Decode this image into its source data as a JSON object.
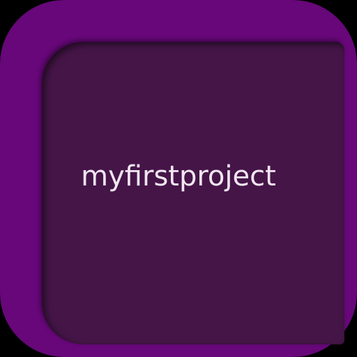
{
  "app_icon": {
    "label": "myfirstproject",
    "colors": {
      "frame": "#670779",
      "panel": "#451548",
      "text": "#f2e6f2",
      "background": "#000000"
    }
  }
}
